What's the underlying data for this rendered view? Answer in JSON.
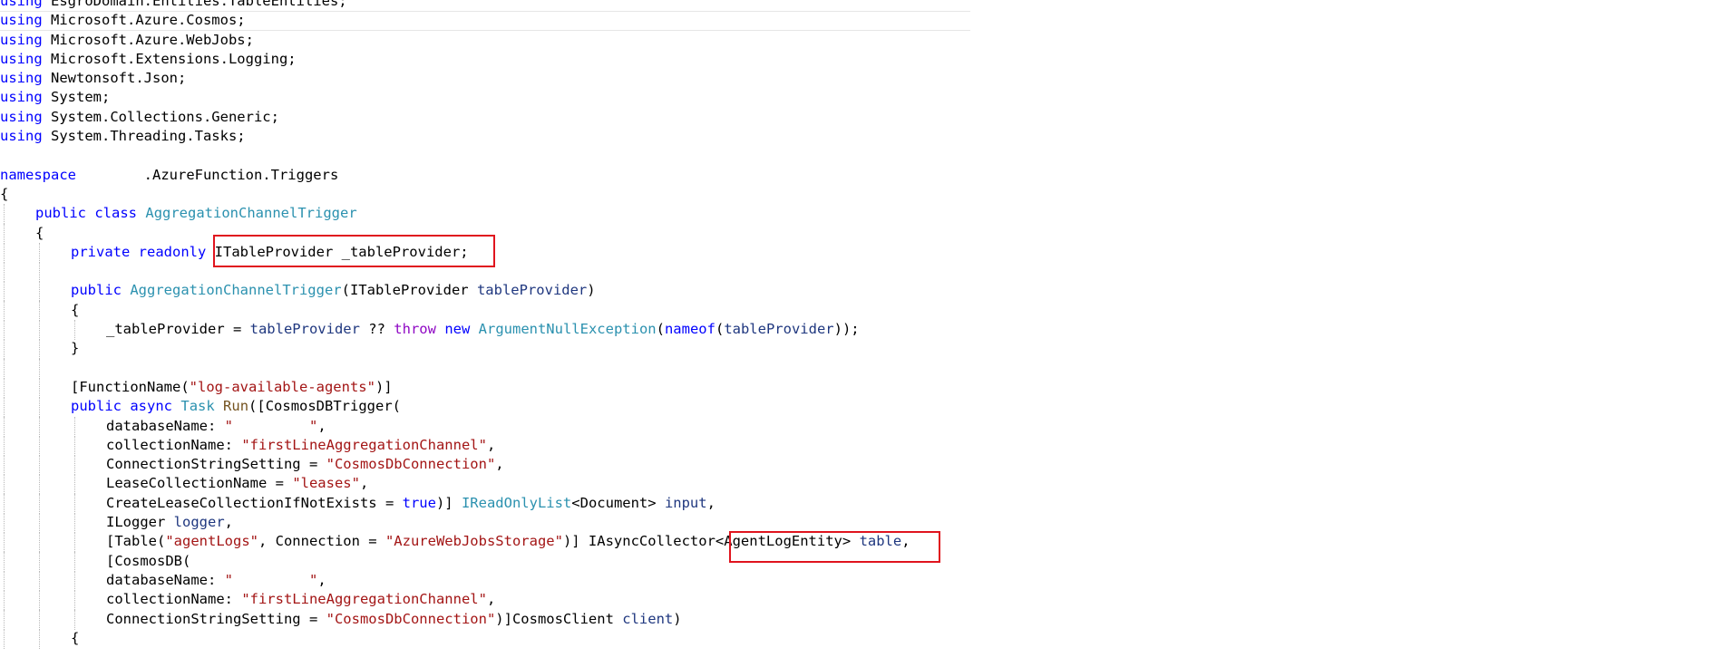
{
  "editor": {
    "language": "C#",
    "lines": [
      {
        "indent": 0,
        "tokens": [
          {
            "t": "kw",
            "v": "using"
          },
          {
            "t": "plain",
            "v": " EsgroDomain.Entities.TableEntities;"
          }
        ]
      },
      {
        "indent": 0,
        "current": true,
        "tokens": [
          {
            "t": "kw",
            "v": "using"
          },
          {
            "t": "plain",
            "v": " Microsoft.Azure.Cosmos;"
          }
        ]
      },
      {
        "indent": 0,
        "tokens": [
          {
            "t": "kw",
            "v": "using"
          },
          {
            "t": "plain",
            "v": " Microsoft.Azure.WebJobs;"
          }
        ]
      },
      {
        "indent": 0,
        "tokens": [
          {
            "t": "kw",
            "v": "using"
          },
          {
            "t": "plain",
            "v": " Microsoft.Extensions.Logging;"
          }
        ]
      },
      {
        "indent": 0,
        "tokens": [
          {
            "t": "kw",
            "v": "using"
          },
          {
            "t": "plain",
            "v": " Newtonsoft.Json;"
          }
        ]
      },
      {
        "indent": 0,
        "tokens": [
          {
            "t": "kw",
            "v": "using"
          },
          {
            "t": "plain",
            "v": " System;"
          }
        ]
      },
      {
        "indent": 0,
        "tokens": [
          {
            "t": "kw",
            "v": "using"
          },
          {
            "t": "plain",
            "v": " System.Collections.Generic;"
          }
        ]
      },
      {
        "indent": 0,
        "tokens": [
          {
            "t": "kw",
            "v": "using"
          },
          {
            "t": "plain",
            "v": " System.Threading.Tasks;"
          }
        ]
      },
      {
        "indent": 0,
        "tokens": []
      },
      {
        "indent": 0,
        "tokens": [
          {
            "t": "kw",
            "v": "namespace"
          },
          {
            "t": "plain",
            "v": "        .AzureFunction.Triggers"
          }
        ]
      },
      {
        "indent": 0,
        "tokens": [
          {
            "t": "plain",
            "v": "{"
          }
        ]
      },
      {
        "indent": 1,
        "tokens": [
          {
            "t": "kw",
            "v": "public"
          },
          {
            "t": "plain",
            "v": " "
          },
          {
            "t": "kw",
            "v": "class"
          },
          {
            "t": "plain",
            "v": " "
          },
          {
            "t": "type",
            "v": "AggregationChannelTrigger"
          }
        ]
      },
      {
        "indent": 1,
        "tokens": [
          {
            "t": "plain",
            "v": "{"
          }
        ]
      },
      {
        "indent": 2,
        "tokens": [
          {
            "t": "kw",
            "v": "private"
          },
          {
            "t": "plain",
            "v": " "
          },
          {
            "t": "kw",
            "v": "readonly"
          },
          {
            "t": "plain",
            "v": " ITableProvider _tableProvider;"
          }
        ]
      },
      {
        "indent": 2,
        "tokens": []
      },
      {
        "indent": 2,
        "tokens": [
          {
            "t": "kw",
            "v": "public"
          },
          {
            "t": "plain",
            "v": " "
          },
          {
            "t": "type",
            "v": "AggregationChannelTrigger"
          },
          {
            "t": "plain",
            "v": "(ITableProvider "
          },
          {
            "t": "param",
            "v": "tableProvider"
          },
          {
            "t": "plain",
            "v": ")"
          }
        ]
      },
      {
        "indent": 2,
        "tokens": [
          {
            "t": "plain",
            "v": "{"
          }
        ]
      },
      {
        "indent": 3,
        "tokens": [
          {
            "t": "plain",
            "v": "_tableProvider = "
          },
          {
            "t": "param",
            "v": "tableProvider"
          },
          {
            "t": "plain",
            "v": " ?? "
          },
          {
            "t": "ctl",
            "v": "throw"
          },
          {
            "t": "plain",
            "v": " "
          },
          {
            "t": "kw",
            "v": "new"
          },
          {
            "t": "plain",
            "v": " "
          },
          {
            "t": "type",
            "v": "ArgumentNullException"
          },
          {
            "t": "plain",
            "v": "("
          },
          {
            "t": "kw",
            "v": "nameof"
          },
          {
            "t": "plain",
            "v": "("
          },
          {
            "t": "param",
            "v": "tableProvider"
          },
          {
            "t": "plain",
            "v": "));"
          }
        ]
      },
      {
        "indent": 2,
        "tokens": [
          {
            "t": "plain",
            "v": "}"
          }
        ]
      },
      {
        "indent": 2,
        "tokens": []
      },
      {
        "indent": 2,
        "tokens": [
          {
            "t": "plain",
            "v": "[FunctionName("
          },
          {
            "t": "str",
            "v": "\"log-available-agents\""
          },
          {
            "t": "plain",
            "v": ")]"
          }
        ]
      },
      {
        "indent": 2,
        "tokens": [
          {
            "t": "kw",
            "v": "public"
          },
          {
            "t": "plain",
            "v": " "
          },
          {
            "t": "kw",
            "v": "async"
          },
          {
            "t": "plain",
            "v": " "
          },
          {
            "t": "type",
            "v": "Task"
          },
          {
            "t": "plain",
            "v": " "
          },
          {
            "t": "method",
            "v": "Run"
          },
          {
            "t": "plain",
            "v": "([CosmosDBTrigger("
          }
        ]
      },
      {
        "indent": 3,
        "tokens": [
          {
            "t": "plain",
            "v": "databaseName: "
          },
          {
            "t": "redacted",
            "v": "\"         \""
          },
          {
            "t": "plain",
            "v": ","
          }
        ]
      },
      {
        "indent": 3,
        "tokens": [
          {
            "t": "plain",
            "v": "collectionName: "
          },
          {
            "t": "str",
            "v": "\"firstLineAggregationChannel\""
          },
          {
            "t": "plain",
            "v": ","
          }
        ]
      },
      {
        "indent": 3,
        "tokens": [
          {
            "t": "plain",
            "v": "ConnectionStringSetting = "
          },
          {
            "t": "str",
            "v": "\"CosmosDbConnection\""
          },
          {
            "t": "plain",
            "v": ","
          }
        ]
      },
      {
        "indent": 3,
        "tokens": [
          {
            "t": "plain",
            "v": "LeaseCollectionName = "
          },
          {
            "t": "str",
            "v": "\"leases\""
          },
          {
            "t": "plain",
            "v": ","
          }
        ]
      },
      {
        "indent": 3,
        "tokens": [
          {
            "t": "plain",
            "v": "CreateLeaseCollectionIfNotExists = "
          },
          {
            "t": "kw",
            "v": "true"
          },
          {
            "t": "plain",
            "v": ")] "
          },
          {
            "t": "type",
            "v": "IReadOnlyList"
          },
          {
            "t": "plain",
            "v": "<Document> "
          },
          {
            "t": "param",
            "v": "input"
          },
          {
            "t": "plain",
            "v": ","
          }
        ]
      },
      {
        "indent": 3,
        "tokens": [
          {
            "t": "plain",
            "v": "ILogger "
          },
          {
            "t": "param",
            "v": "logger"
          },
          {
            "t": "plain",
            "v": ","
          }
        ]
      },
      {
        "indent": 3,
        "tokens": [
          {
            "t": "plain",
            "v": "[Table("
          },
          {
            "t": "str",
            "v": "\"agentLogs\""
          },
          {
            "t": "plain",
            "v": ", Connection = "
          },
          {
            "t": "str",
            "v": "\"AzureWebJobsStorage\""
          },
          {
            "t": "plain",
            "v": ")] IAsyncCollector<AgentLogEntity> "
          },
          {
            "t": "param",
            "v": "table"
          },
          {
            "t": "plain",
            "v": ","
          }
        ]
      },
      {
        "indent": 3,
        "tokens": [
          {
            "t": "plain",
            "v": "[CosmosDB("
          }
        ]
      },
      {
        "indent": 3,
        "tokens": [
          {
            "t": "plain",
            "v": "databaseName: "
          },
          {
            "t": "redacted",
            "v": "\"         \""
          },
          {
            "t": "plain",
            "v": ","
          }
        ]
      },
      {
        "indent": 3,
        "tokens": [
          {
            "t": "plain",
            "v": "collectionName: "
          },
          {
            "t": "str",
            "v": "\"firstLineAggregationChannel\""
          },
          {
            "t": "plain",
            "v": ","
          }
        ]
      },
      {
        "indent": 3,
        "tokens": [
          {
            "t": "plain",
            "v": "ConnectionStringSetting = "
          },
          {
            "t": "str",
            "v": "\"CosmosDbConnection\""
          },
          {
            "t": "plain",
            "v": ")]CosmosClient "
          },
          {
            "t": "param",
            "v": "client"
          },
          {
            "t": "plain",
            "v": ")"
          }
        ]
      },
      {
        "indent": 2,
        "tokens": [
          {
            "t": "plain",
            "v": "{"
          }
        ]
      }
    ]
  },
  "annotations": {
    "color": "#e0141e",
    "boxes": [
      "ITableProvider _tableProvider;",
      "<AgentLogEntity> table,"
    ]
  },
  "colors": {
    "keyword": "#0000ff",
    "type": "#2b91af",
    "string": "#a31515",
    "control": "#8f08c4",
    "parameter": "#1f377f",
    "method": "#74531f"
  }
}
